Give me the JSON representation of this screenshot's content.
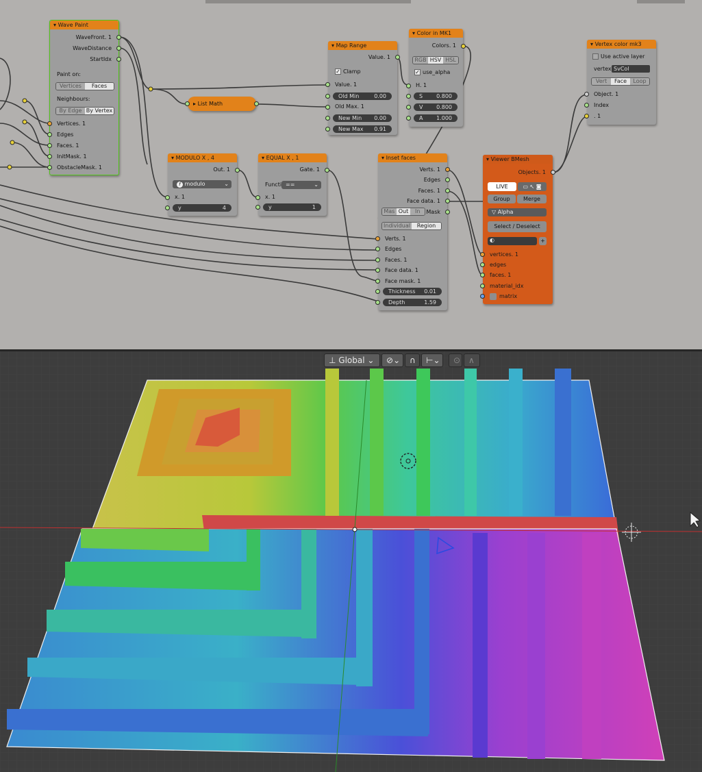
{
  "colors": {
    "node_header": "#e2821a",
    "node_body": "#9d9d9d",
    "editor_bg": "#b2b0ae",
    "viewer_body": "#d35a1a",
    "socket": "#a8e08a"
  },
  "wave_paint": {
    "title": "Wave Paint",
    "outputs": [
      "WaveFront. 1",
      "WaveDistance",
      "StartIdx"
    ],
    "paint_on": "Paint on:",
    "paint_modes": [
      "Vertices",
      "Faces"
    ],
    "neighbours": "Neighbours:",
    "neigh_modes": [
      "By Edge",
      "By Vertex"
    ],
    "inputs": [
      "Vertices. 1",
      "Edges",
      "Faces. 1",
      "InitMask. 1",
      "ObstacleMask. 1"
    ]
  },
  "list_math": {
    "title": "List Math"
  },
  "map_range": {
    "title": "Map Range",
    "output": "Value. 1",
    "clamp": "Clamp",
    "value": "Value. 1",
    "old_min": "Old Min",
    "old_min_v": "0.00",
    "old_max": "Old Max. 1",
    "new_min": "New Min",
    "new_min_v": "0.00",
    "new_max": "New Max",
    "new_max_v": "0.91"
  },
  "color_in": {
    "title": "Color in MK1",
    "output": "Colors. 1",
    "modes": [
      "RGB",
      "HSV",
      "HSL"
    ],
    "use_alpha": "use_alpha",
    "h": "H. 1",
    "s": "S",
    "s_v": "0.800",
    "v": "V",
    "v_v": "0.800",
    "a": "A",
    "a_v": "1.000"
  },
  "modulo": {
    "title": "MODULO X , 4",
    "output": "Out. 1",
    "func": "modulo",
    "x": "x. 1",
    "y": "y",
    "y_v": "4"
  },
  "equal": {
    "title": "EQUAL X , 1",
    "output": "Gate. 1",
    "func": "Functi",
    "op": "==",
    "x": "x. 1",
    "y": "y",
    "y_v": "1"
  },
  "inset": {
    "title": "Inset faces",
    "outputs": [
      "Verts. 1",
      "Edges",
      "Faces. 1",
      "Face data. 1",
      "Mask"
    ],
    "modes": [
      "Mas",
      "Out",
      "In"
    ],
    "modes2": [
      "Individual",
      "Region"
    ],
    "inputs": [
      "Verts. 1",
      "Edges",
      "Faces. 1",
      "Face data. 1",
      "Face mask. 1"
    ],
    "thickness": "Thickness",
    "thickness_v": "0.01",
    "depth": "Depth",
    "depth_v": "1.59"
  },
  "viewer": {
    "title": "Viewer BMesh",
    "output": "Objects. 1",
    "live": "LIVE",
    "group": "Group",
    "merge": "Merge",
    "alpha": "Alpha",
    "select": "Select / Deselect",
    "inputs": [
      "vertices. 1",
      "edges",
      "faces. 1",
      "material_idx",
      "matrix"
    ]
  },
  "vcolor": {
    "title": "Vertex color mk3",
    "use_active": "Use active layer",
    "vertex": "vertex",
    "layer": "SvCol",
    "modes": [
      "Vert",
      "Face",
      "Loop"
    ],
    "inputs": [
      "Object. 1",
      "Index",
      ". 1"
    ]
  },
  "viewport": {
    "orientation": "Global",
    "icons": [
      "link-icon",
      "snap-icon",
      "snap-target-icon",
      "proportional-icon",
      "falloff-icon"
    ]
  }
}
